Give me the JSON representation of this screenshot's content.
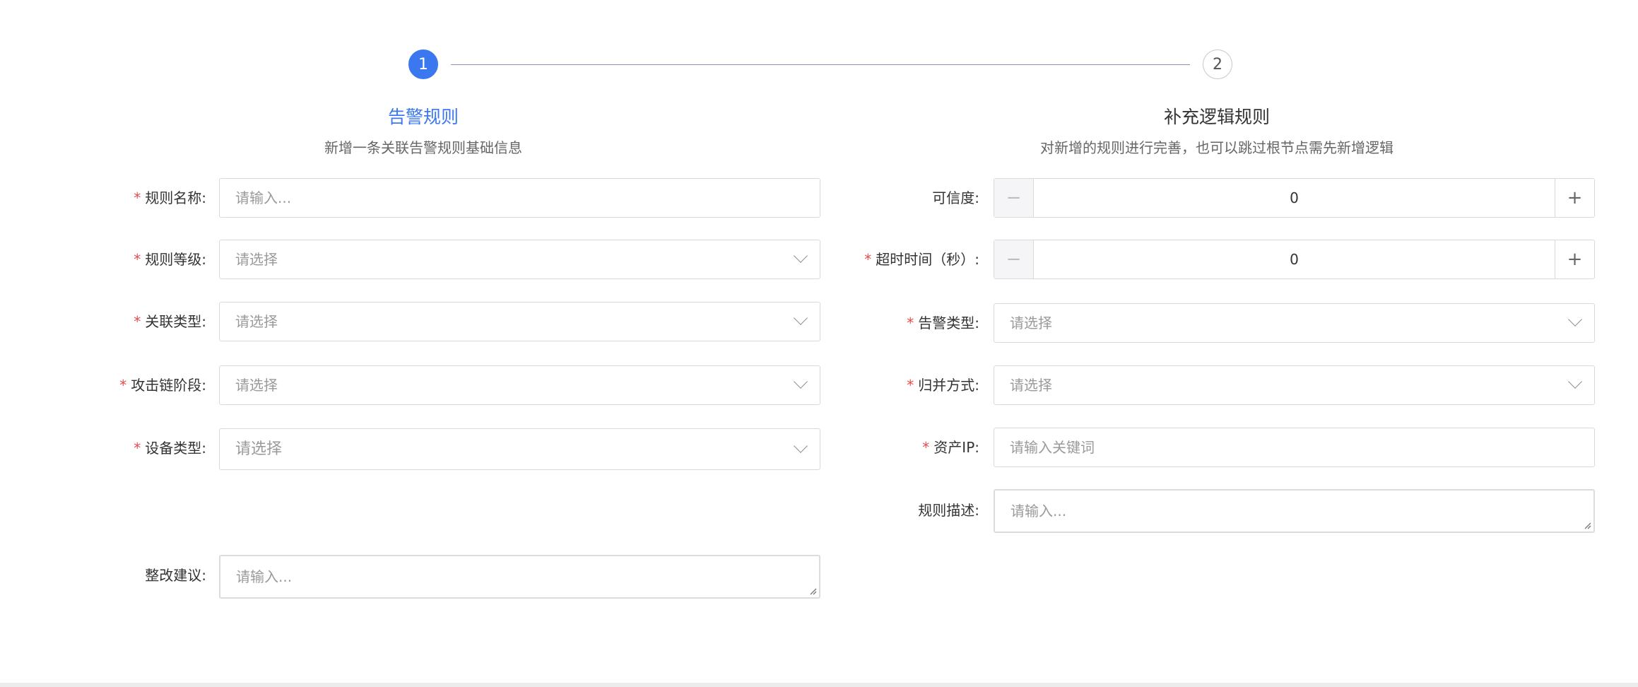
{
  "steps": [
    {
      "number": "1",
      "title": "告警规则",
      "description": "新增一条关联告警规则基础信息",
      "active": true
    },
    {
      "number": "2",
      "title": "补充逻辑规则",
      "description": "对新增的规则进行完善，也可以跳过根节点需先新增逻辑",
      "active": false
    }
  ],
  "left_form": {
    "rule_name": {
      "label": "规则名称:",
      "required": true,
      "placeholder": "请输入..."
    },
    "rule_level": {
      "label": "规则等级:",
      "required": true,
      "placeholder": "请选择"
    },
    "relation_type": {
      "label": "关联类型:",
      "required": true,
      "placeholder": "请选择"
    },
    "attack_chain_stage": {
      "label": "攻击链阶段:",
      "required": true,
      "placeholder": "请选择"
    },
    "device_type": {
      "label": "设备类型:",
      "required": true,
      "placeholder": "请选择"
    },
    "rectification": {
      "label": "整改建议:",
      "required": false,
      "placeholder": "请输入..."
    }
  },
  "right_form": {
    "credibility": {
      "label": "可信度:",
      "required": false,
      "value": "0",
      "minus": "−",
      "plus": "+"
    },
    "timeout": {
      "label": "超时时间（秒）:",
      "required": true,
      "value": "0",
      "minus": "−",
      "plus": "+"
    },
    "alarm_type": {
      "label": "告警类型:",
      "required": true,
      "placeholder": "请选择"
    },
    "merge_mode": {
      "label": "归并方式:",
      "required": true,
      "placeholder": "请选择"
    },
    "asset_ip": {
      "label": "资产IP:",
      "required": true,
      "placeholder": "请输入关键词"
    },
    "rule_desc": {
      "label": "规则描述:",
      "required": false,
      "placeholder": "请输入..."
    }
  },
  "required_mark": "*",
  "colors": {
    "accent": "#3b78f0",
    "required": "#e64b4b",
    "border": "#d9d9d9"
  }
}
